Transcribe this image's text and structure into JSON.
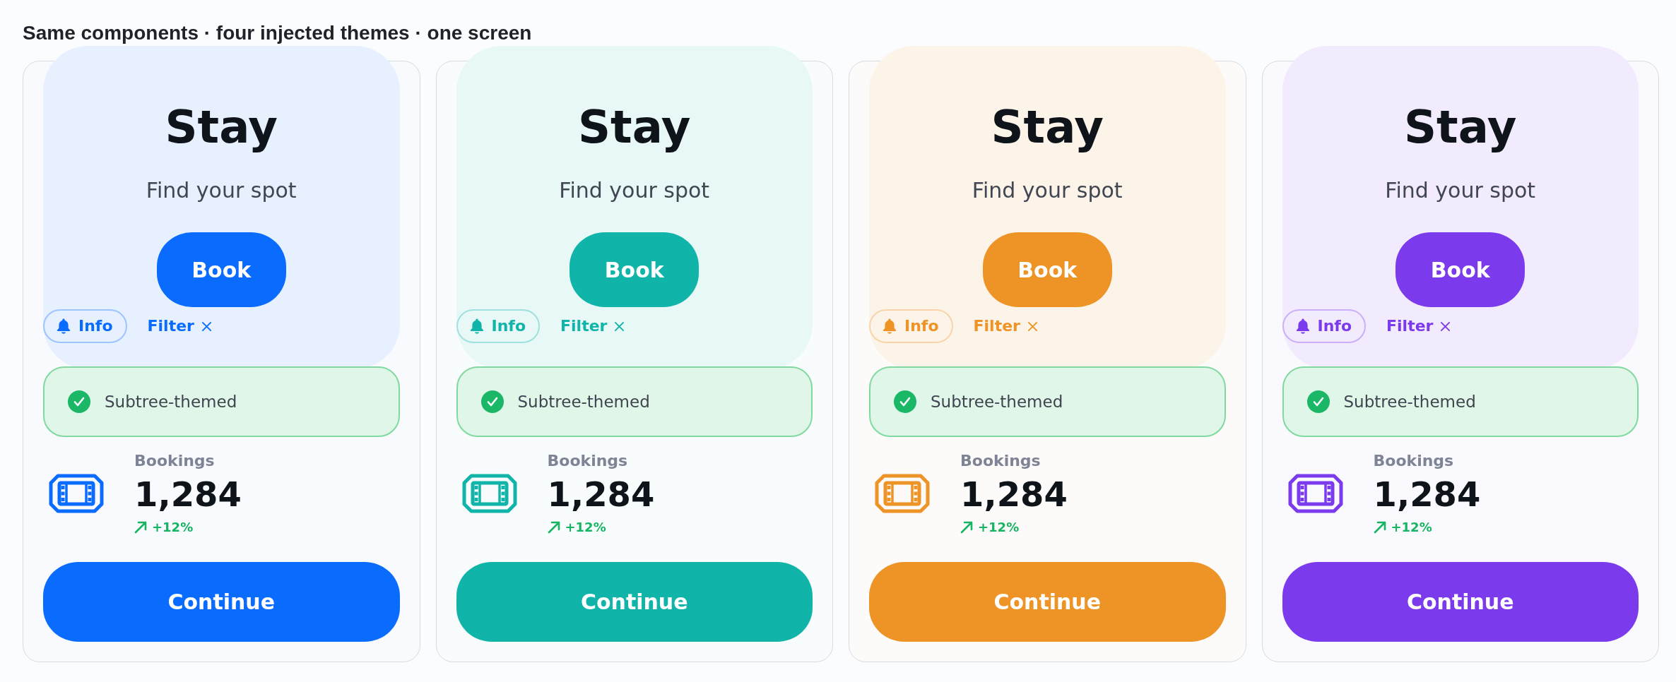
{
  "heading": "Same components · four injected themes · one screen",
  "themes": [
    {
      "color": "#0a6cff",
      "title": "Stay",
      "subtitle": "Find your spot",
      "primary_button": "Book",
      "chips": [
        {
          "kind": "tag",
          "label": "Info"
        },
        {
          "kind": "removable",
          "label": "Filter"
        }
      ],
      "status": {
        "label": "Subtree-themed"
      },
      "stat": {
        "label": "Bookings",
        "value": "1,284",
        "change": "+12%"
      },
      "action_button": "Continue"
    },
    {
      "color": "#10b4a9",
      "title": "Stay",
      "subtitle": "Find your spot",
      "primary_button": "Book",
      "chips": [
        {
          "kind": "tag",
          "label": "Info"
        },
        {
          "kind": "removable",
          "label": "Filter"
        }
      ],
      "status": {
        "label": "Subtree-themed"
      },
      "stat": {
        "label": "Bookings",
        "value": "1,284",
        "change": "+12%"
      },
      "action_button": "Continue"
    },
    {
      "color": "#ee9325",
      "title": "Stay",
      "subtitle": "Find your spot",
      "primary_button": "Book",
      "chips": [
        {
          "kind": "tag",
          "label": "Info"
        },
        {
          "kind": "removable",
          "label": "Filter"
        }
      ],
      "status": {
        "label": "Subtree-themed"
      },
      "stat": {
        "label": "Bookings",
        "value": "1,284",
        "change": "+12%"
      },
      "action_button": "Continue"
    },
    {
      "color": "#7c3aed",
      "title": "Stay",
      "subtitle": "Find your spot",
      "primary_button": "Book",
      "chips": [
        {
          "kind": "tag",
          "label": "Info"
        },
        {
          "kind": "removable",
          "label": "Filter"
        }
      ],
      "status": {
        "label": "Subtree-themed"
      },
      "stat": {
        "label": "Bookings",
        "value": "1,284",
        "change": "+12%"
      },
      "action_button": "Continue"
    }
  ]
}
